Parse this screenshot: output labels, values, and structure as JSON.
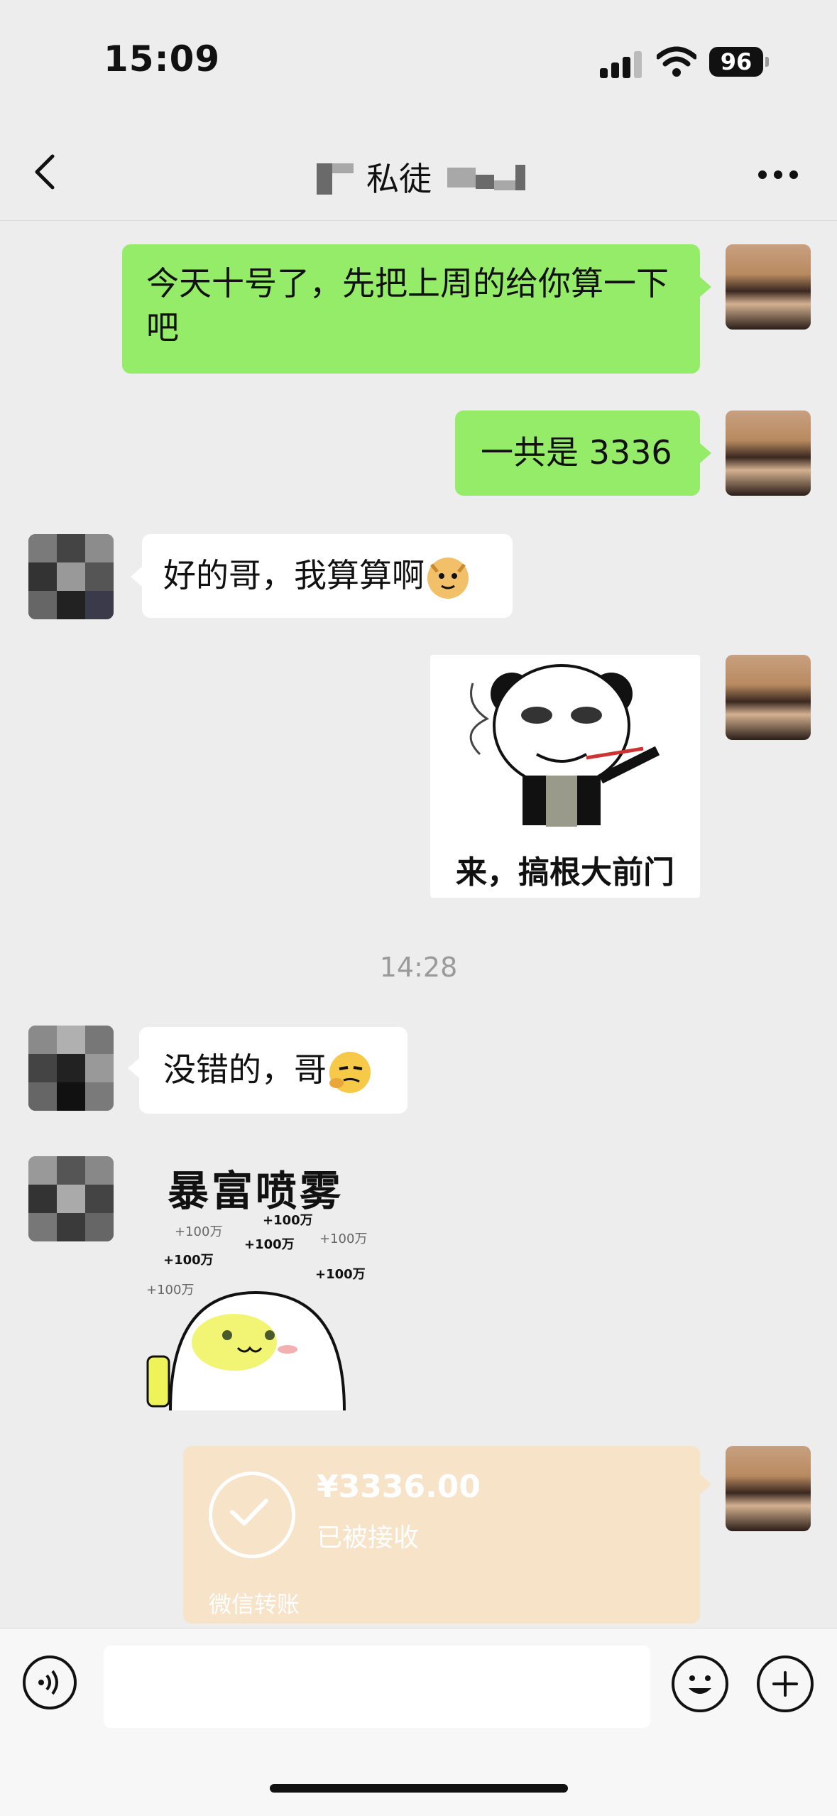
{
  "status_bar": {
    "time": "15:09",
    "battery": "96"
  },
  "nav": {
    "title": "私徒"
  },
  "messages": [
    {
      "side": "me",
      "type": "text",
      "text": "今天十号了，先把上周的给你算一下吧"
    },
    {
      "side": "me",
      "type": "text",
      "text": "一共是 3336"
    },
    {
      "side": "them",
      "type": "text",
      "text": "好的哥，我算算啊",
      "emoji": "doge-icon"
    },
    {
      "side": "me",
      "type": "sticker",
      "caption": "来，搞根大前门",
      "sticker": "panda-smoking-sticker"
    },
    {
      "side": "system",
      "type": "time",
      "text": "14:28"
    },
    {
      "side": "them",
      "type": "text",
      "text": "没错的，哥",
      "emoji": "smirk-icon"
    },
    {
      "side": "them",
      "type": "sticker",
      "caption": "暴富喷雾",
      "sticker": "rich-spray-sticker",
      "floats": [
        "+100万",
        "+100万",
        "+100万",
        "+100万",
        "+100万",
        "+100万",
        "+100万"
      ]
    },
    {
      "side": "me",
      "type": "transfer",
      "amount": "¥3336.00",
      "status": "已被接收",
      "footer": "微信转账"
    }
  ],
  "colors": {
    "bubble_me": "#95ec69",
    "bubble_them": "#ffffff",
    "transfer_bg": "#f7e3c8",
    "background": "#ededed"
  }
}
